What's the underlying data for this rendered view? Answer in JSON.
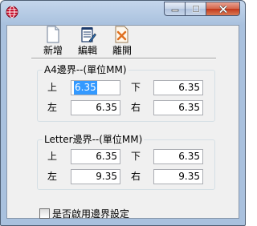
{
  "window": {
    "title": "",
    "buttons": [
      "minimize",
      "maximize",
      "close"
    ]
  },
  "toolbar": {
    "items": [
      {
        "label": "新增",
        "icon": "new-document-icon"
      },
      {
        "label": "編輯",
        "icon": "edit-notepad-icon"
      },
      {
        "label": "離開",
        "icon": "exit-icon"
      }
    ]
  },
  "a4": {
    "title": "A4邊界--(單位MM)",
    "top_label": "上",
    "top_value": "6.35",
    "bottom_label": "下",
    "bottom_value": "6.35",
    "left_label": "左",
    "left_value": "6.35",
    "right_label": "右",
    "right_value": "6.35"
  },
  "letter": {
    "title": "Letter邊界--(單位MM)",
    "top_label": "上",
    "top_value": "6.35",
    "bottom_label": "下",
    "bottom_value": "6.35",
    "left_label": "左",
    "left_value": "9.35",
    "right_label": "右",
    "right_value": "9.35"
  },
  "options": {
    "enable_margin_label": "是否啟用邊界設定",
    "enable_margin_checked": false
  },
  "colors": {
    "titlebar": "#b9cde6",
    "client": "#f0f0f0",
    "selection": "#3399ff",
    "close_button": "#c94a2c"
  }
}
